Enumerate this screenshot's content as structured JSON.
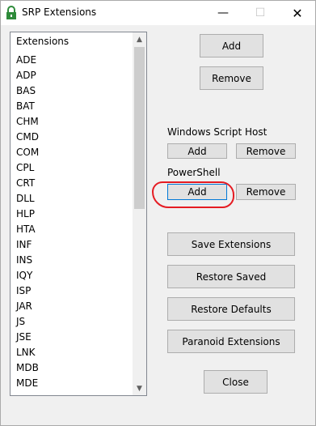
{
  "window": {
    "title": "SRP Extensions",
    "controls": {
      "minimize": "—",
      "maximize": "☐",
      "close": "✕"
    }
  },
  "list": {
    "header": "Extensions",
    "items": [
      "ADE",
      "ADP",
      "BAS",
      "BAT",
      "CHM",
      "CMD",
      "COM",
      "CPL",
      "CRT",
      "DLL",
      "HLP",
      "HTA",
      "INF",
      "INS",
      "IQY",
      "ISP",
      "JAR",
      "JS",
      "JSE",
      "LNK",
      "MDB",
      "MDE"
    ],
    "scroll": {
      "up": "▲",
      "down": "▼"
    }
  },
  "main_buttons": {
    "add": "Add",
    "remove": "Remove"
  },
  "wsh": {
    "label": "Windows Script Host",
    "add": "Add",
    "remove": "Remove"
  },
  "powershell": {
    "label": "PowerShell",
    "add": "Add",
    "remove": "Remove"
  },
  "actions": {
    "save": "Save Extensions",
    "restore_saved": "Restore Saved",
    "restore_defaults": "Restore Defaults",
    "paranoid": "Paranoid Extensions",
    "close": "Close"
  },
  "colors": {
    "annotation": "#e51c23",
    "focus_border": "#0078d7",
    "icon_green": "#2e8b3a"
  }
}
